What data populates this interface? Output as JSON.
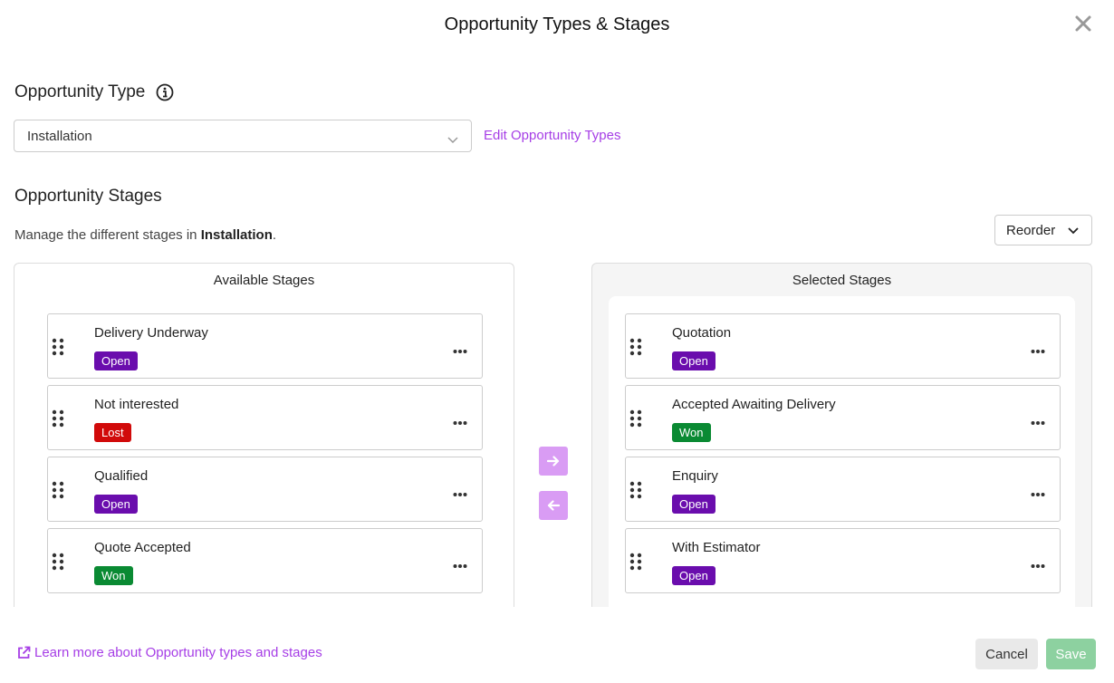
{
  "dialog": {
    "title": "Opportunity Types & Stages",
    "close_icon": "close-icon"
  },
  "type_section": {
    "title": "Opportunity Type",
    "info_icon": "info-icon",
    "selected_type": "Installation",
    "edit_link": "Edit Opportunity Types"
  },
  "stages_section": {
    "title": "Opportunity Stages",
    "manage_prefix": "Manage the different stages in ",
    "manage_type": "Installation",
    "manage_suffix": ".",
    "reorder_label": "Reorder"
  },
  "available": {
    "title": "Available Stages",
    "items": [
      {
        "name": "Delivery Underway",
        "status": "Open"
      },
      {
        "name": "Not interested",
        "status": "Lost"
      },
      {
        "name": "Qualified",
        "status": "Open"
      },
      {
        "name": "Quote Accepted",
        "status": "Won"
      }
    ]
  },
  "selected": {
    "title": "Selected Stages",
    "items": [
      {
        "name": "Quotation",
        "status": "Open"
      },
      {
        "name": "Accepted Awaiting Delivery",
        "status": "Won"
      },
      {
        "name": "Enquiry",
        "status": "Open"
      },
      {
        "name": "With Estimator",
        "status": "Open"
      }
    ]
  },
  "status_colors": {
    "Open": "#6a0dad",
    "Lost": "#d10a0a",
    "Won": "#0a8a33"
  },
  "footer": {
    "learn_more": "Learn more about Opportunity types and stages",
    "cancel_label": "Cancel",
    "save_label": "Save"
  },
  "colors": {
    "accent": "#a63ee6",
    "arrow_button": "#d99cf4",
    "save_disabled": "#8dd1a0"
  }
}
